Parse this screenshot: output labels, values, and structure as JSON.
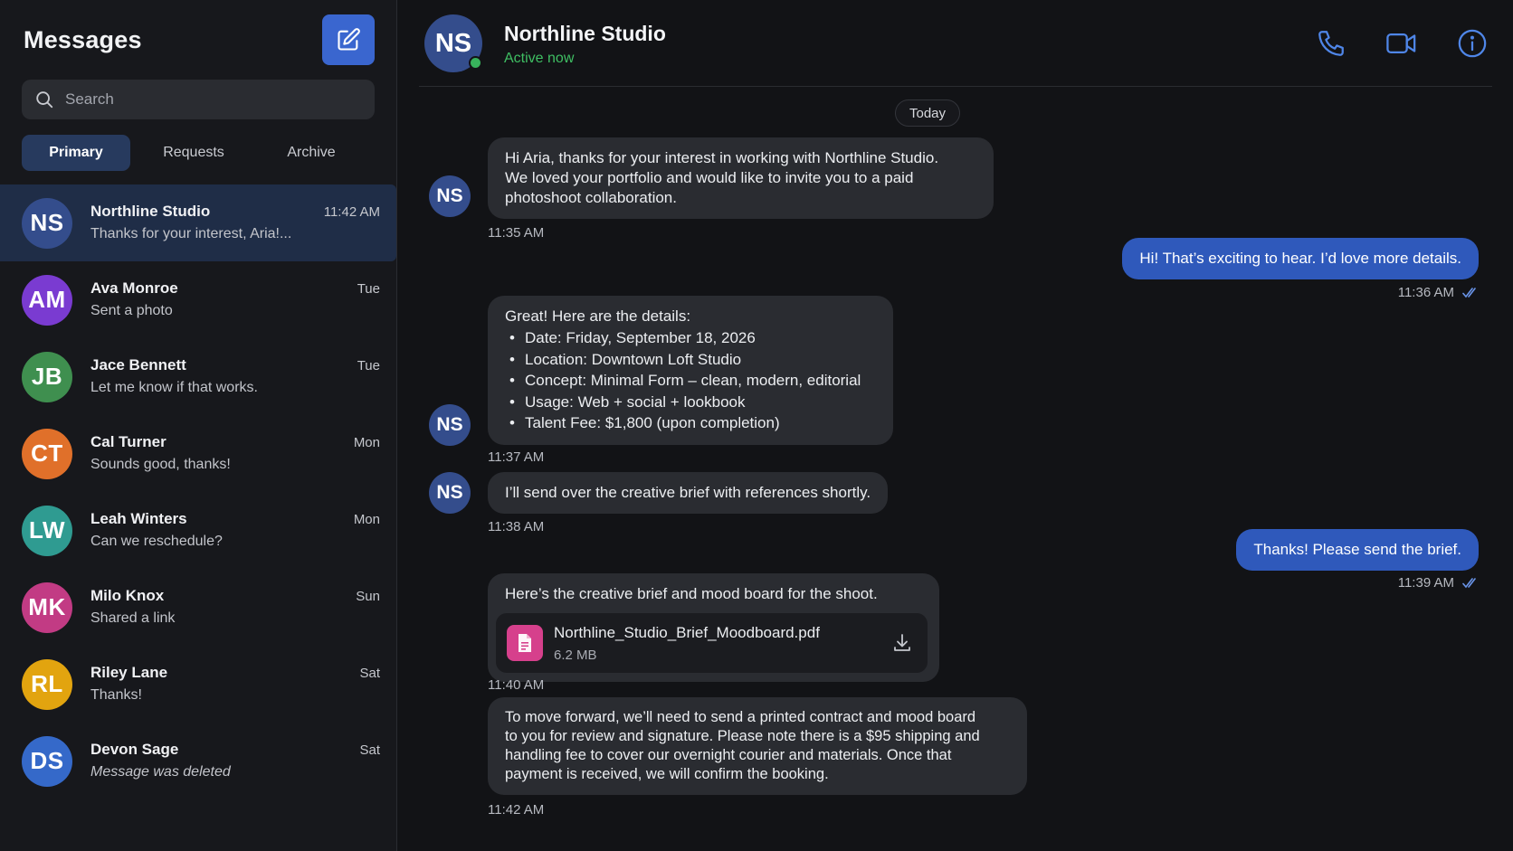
{
  "sidebar": {
    "title": "Messages",
    "search_placeholder": "Search",
    "tabs": [
      {
        "label": "Primary",
        "active": true
      },
      {
        "label": "Requests",
        "active": false
      },
      {
        "label": "Archive",
        "active": false
      }
    ],
    "conversations": [
      {
        "initials": "NS",
        "name": "Northline Studio",
        "time": "11:42 AM",
        "preview": "Thanks for your interest, Aria!...",
        "color": "#344d8c",
        "active": true
      },
      {
        "initials": "AM",
        "name": "Ava Monroe",
        "time": "Tue",
        "preview": "Sent a photo",
        "color": "#7a3bd1"
      },
      {
        "initials": "JB",
        "name": "Jace Bennett",
        "time": "Tue",
        "preview": "Let me know if that works.",
        "color": "#3f8f4f"
      },
      {
        "initials": "CT",
        "name": "Cal Turner",
        "time": "Mon",
        "preview": "Sounds good, thanks!",
        "color": "#e0702a"
      },
      {
        "initials": "LW",
        "name": "Leah Winters",
        "time": "Mon",
        "preview": "Can we reschedule?",
        "color": "#2f9b91"
      },
      {
        "initials": "MK",
        "name": "Milo Knox",
        "time": "Sun",
        "preview": "Shared a link",
        "color": "#c23b84"
      },
      {
        "initials": "RL",
        "name": "Riley Lane",
        "time": "Sat",
        "preview": "Thanks!",
        "color": "#e2a40f"
      },
      {
        "initials": "DS",
        "name": "Devon Sage",
        "time": "Sat",
        "preview": "Message was deleted",
        "color": "#3569c9",
        "italic": true
      }
    ]
  },
  "chat": {
    "contact_initials": "NS",
    "contact_name": "Northline Studio",
    "status": "Active now",
    "actions": [
      "phone-icon",
      "video-icon",
      "info-icon"
    ],
    "day_label": "Today",
    "messages": {
      "m1": {
        "text": "Hi Aria, thanks for your interest in working with Northline Studio.\nWe loved your portfolio and would like to invite you to a paid\nphotoshoot collaboration.",
        "time": "11:35 AM"
      },
      "m2": {
        "text": "Hi! That’s exciting to hear. I’d love more details.",
        "time": "11:36 AM"
      },
      "m3": {
        "intro": "Great! Here are the details:",
        "items": [
          "Date: Friday, September 18, 2026",
          "Location: Downtown Loft Studio",
          "Concept: Minimal Form – clean, modern, editorial",
          "Usage: Web + social + lookbook",
          "Talent Fee: $1,800 (upon completion)"
        ],
        "time": "11:37 AM"
      },
      "m4": {
        "text": "I’ll send over the creative brief with references shortly.",
        "time": "11:38 AM"
      },
      "m5": {
        "text": "Thanks! Please send the brief.",
        "time": "11:39 AM"
      },
      "m6": {
        "text": "Here’s the creative brief and mood board for the shoot.",
        "file_name": "Northline_Studio_Brief_Moodboard.pdf",
        "file_size": "6.2 MB",
        "time": "11:40 AM"
      },
      "m7": {
        "text": "To move forward, we’ll need to send a printed contract and mood board\nto you for review and signature. Please note there is a $95 shipping and\nhandling fee to cover our overnight courier and materials. Once that\npayment is received, we will confirm the booking.",
        "time": "11:42 AM"
      }
    }
  },
  "colors": {
    "accent": "#3a66cf",
    "outgoing_bubble": "#2f59bb",
    "incoming_bubble": "#2a2c31",
    "online": "#38b25c",
    "background": "#121316"
  }
}
